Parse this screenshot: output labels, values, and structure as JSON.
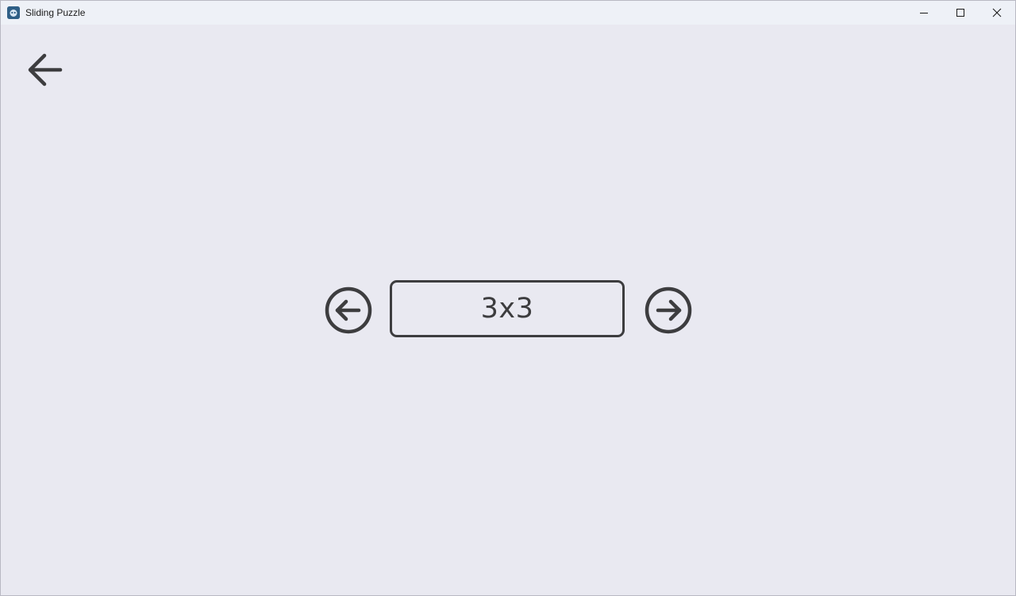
{
  "window": {
    "title": "Sliding Puzzle",
    "icon": "godot-app-icon",
    "controls": [
      "minimize-icon",
      "maximize-icon",
      "close-icon"
    ]
  },
  "navigation": {
    "back_icon": "arrow-left-icon"
  },
  "size_selector": {
    "prev_icon": "circle-arrow-left-icon",
    "next_icon": "circle-arrow-right-icon",
    "value": "3x3"
  },
  "colors": {
    "background": "#e9e9f1",
    "titlebar": "#eef1f7",
    "foreground": "#3d3d3f"
  }
}
